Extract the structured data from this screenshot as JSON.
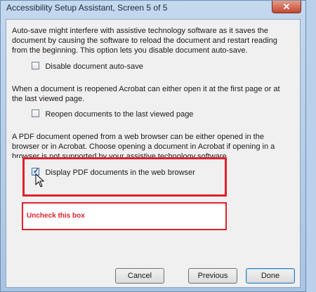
{
  "window": {
    "title": "Accessibility Setup Assistant, Screen 5 of 5",
    "close_label": "✕"
  },
  "sections": {
    "autosave": {
      "text": "Auto-save might interfere with assistive technology software as it saves the document by causing the software to reload the document and restart reading from the beginning. This option lets you disable document auto-save.",
      "checkbox_label": "Disable document auto-save",
      "checked": false
    },
    "reopen": {
      "text": "When a document is reopened Acrobat can either open it at the first page or at the last viewed page.",
      "checkbox_label": "Reopen documents to the last viewed page",
      "checked": false
    },
    "browser": {
      "text": "A PDF document opened from a web browser can be either opened in the browser or in Acrobat. Choose opening a document in Acrobat if opening in a browser is not supported by your assistive technology software.",
      "checkbox_label": "Display PDF documents in the web browser",
      "checked": true
    }
  },
  "annotation": {
    "note": "Uncheck this box",
    "color": "#e0202c"
  },
  "buttons": {
    "cancel": "Cancel",
    "previous": "Previous",
    "done": "Done"
  }
}
